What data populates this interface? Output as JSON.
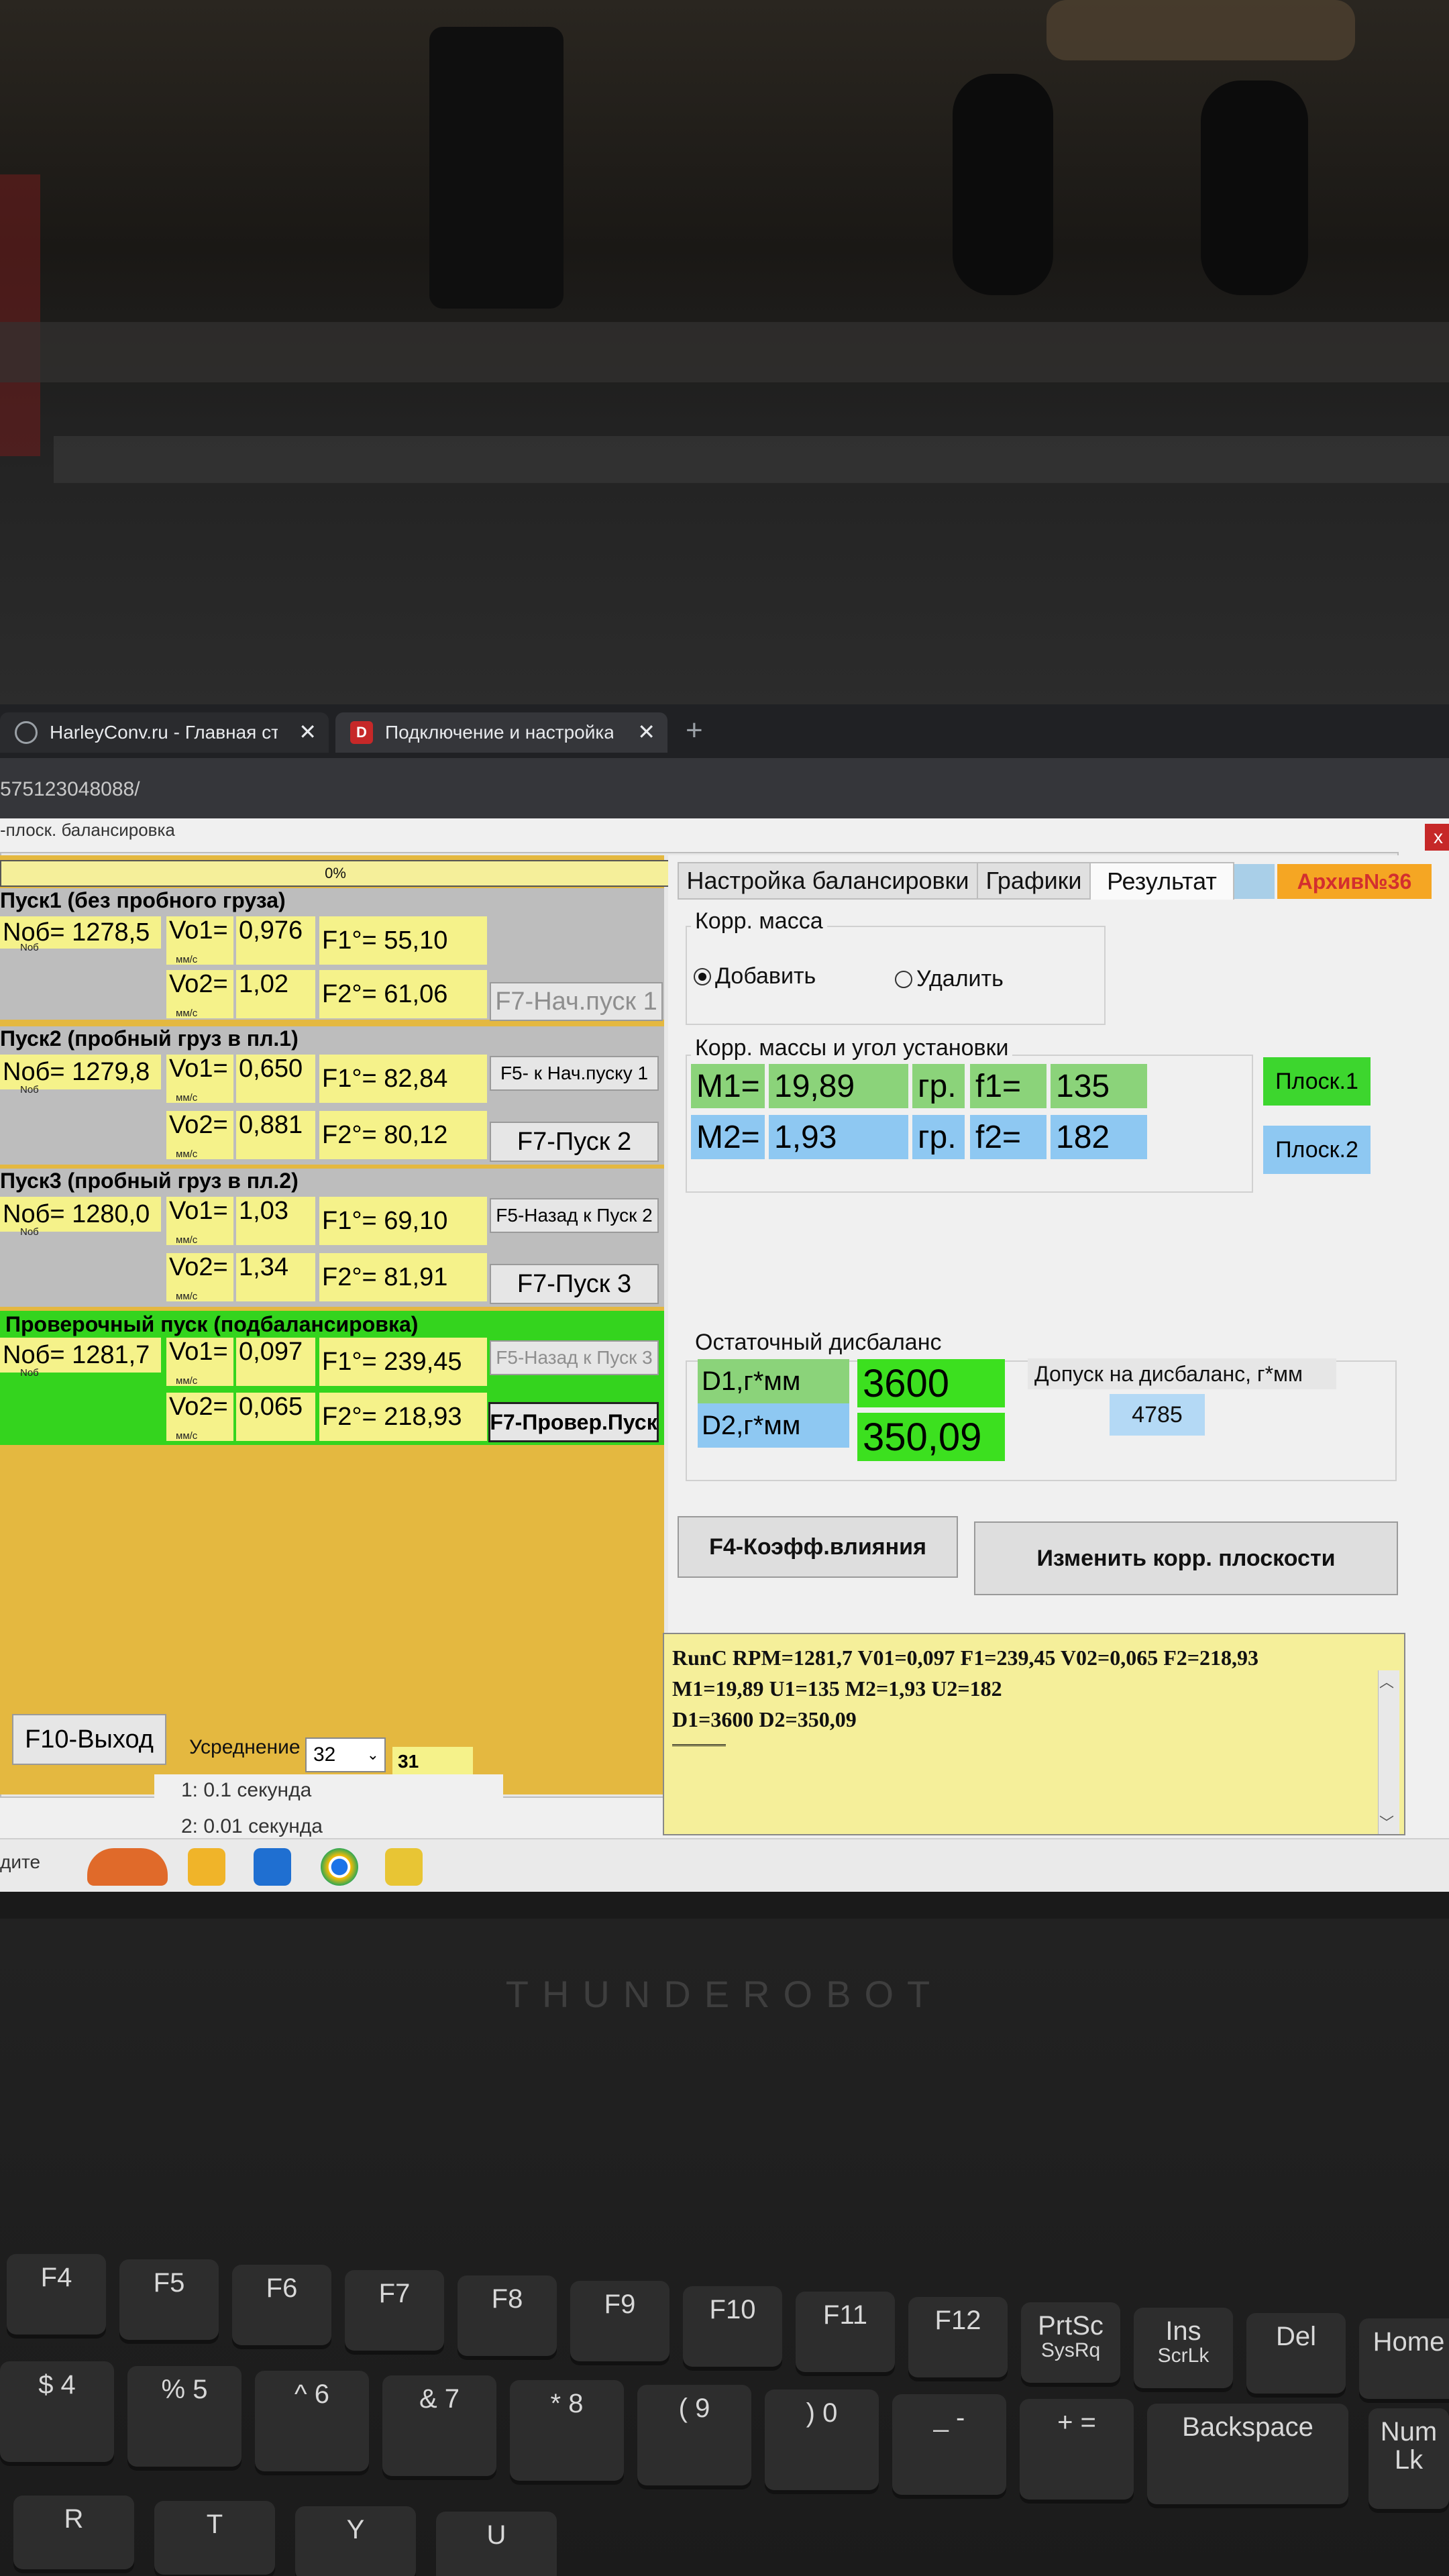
{
  "browser": {
    "tabs": [
      {
        "title": "HarleyConv.ru - Главная стран",
        "icon": "globe-icon"
      },
      {
        "title": "Подключение и настройка ча",
        "icon": "d-logo-icon"
      }
    ],
    "new_tab": "+",
    "close": "✕",
    "url": "575123048088/"
  },
  "window": {
    "title": "-плоск. балансировка",
    "close": "x",
    "progress": "0%"
  },
  "left": {
    "run1": {
      "title": "Пуск1 (без пробного груза)",
      "n": "Nоб= 1278,5",
      "n_sub": "Nоб",
      "vo1_label": "Vo1=",
      "vo1_unit": "мм/с",
      "vo1": "0,976",
      "f1": "F1°= 55,10",
      "vo2_label": "Vo2=",
      "vo2_unit": "мм/с",
      "vo2": "1,02",
      "f2": "F2°= 61,06",
      "btn": "F7-Нач.пуск 1"
    },
    "run2": {
      "title": "Пуск2 (пробный груз в пл.1)",
      "n": "Nоб= 1279,8",
      "n_sub": "Nоб",
      "vo1_label": "Vo1=",
      "vo1_unit": "мм/с",
      "vo1": "0,650",
      "f1": "F1°= 82,84",
      "vo2_label": "Vo2=",
      "vo2_unit": "мм/с",
      "vo2": "0,881",
      "f2": "F2°= 80,12",
      "btn_back": "F5- к Нач.пуску 1",
      "btn": "F7-Пуск 2"
    },
    "run3": {
      "title": "Пуск3 (пробный груз в пл.2)",
      "n": "Nоб= 1280,0",
      "n_sub": "Nоб",
      "vo1_label": "Vo1=",
      "vo1_unit": "мм/с",
      "vo1": "1,03",
      "f1": "F1°= 69,10",
      "vo2_label": "Vo2=",
      "vo2_unit": "мм/с",
      "vo2": "1,34",
      "f2": "F2°= 81,91",
      "btn_back": "F5-Назад к Пуск 2",
      "btn": "F7-Пуск 3"
    },
    "check": {
      "title": "Проверочный пуск (подбалансировка)",
      "n": "Nоб= 1281,7",
      "n_sub": "Nоб",
      "vo1_label": "Vo1=",
      "vo1_unit": "мм/с",
      "vo1": "0,097",
      "f1": "F1°= 239,45",
      "vo2_label": "Vo2=",
      "vo2_unit": "мм/с",
      "vo2": "0,065",
      "f2": "F2°= 218,93",
      "btn_back": "F5-Назад к Пуск 3",
      "btn": "F7-Провер.Пуск"
    },
    "exit": "F10-Выход",
    "averaging_label": "Усреднение",
    "averaging_value": "32",
    "averaging_count": "31",
    "dropdown_items": [
      "1: 0.1 секунда",
      "2: 0.01 секунда"
    ]
  },
  "right": {
    "tabs": [
      "Настройка балансировки",
      "Графики",
      "Результат"
    ],
    "archive": "Архив№36",
    "corr_mass": {
      "legend": "Корр. масса",
      "add": "Добавить",
      "remove": "Удалить"
    },
    "corr_masses": {
      "legend": "Корр. массы и угол установки",
      "m1_label": "M1=",
      "m1": "19,89",
      "unit1": "гр.",
      "f1_label": "f1=",
      "f1": "135",
      "m2_label": "M2=",
      "m2": "1,93",
      "unit2": "гр.",
      "f2_label": "f2=",
      "f2": "182",
      "plane1": "Плоск.1",
      "plane2": "Плоск.2"
    },
    "residual": {
      "legend": "Остаточный дисбаланс",
      "d1_label": "D1,г*мм",
      "d1": "3600",
      "d2_label": "D2,г*мм",
      "d2": "350,09",
      "tol_label": "Допуск на дисбаланс, г*мм",
      "tol": "4785"
    },
    "btn_coef": "F4-Коэфф.влияния",
    "btn_change": "Изменить корр. плоскости",
    "log": [
      "RunC  RPM=1281,7 V01=0,097 F1=239,45 V02=0,065 F2=218,93",
      "M1=19,89 U1=135 M2=1,93 U2=182",
      "D1=3600 D2=350,09"
    ]
  },
  "taskbar": {
    "search": "дите"
  },
  "laptop": {
    "brand": "THUNDEROBOT",
    "fkeys": [
      "F4",
      "F5",
      "F6",
      "F7",
      "F8",
      "F9",
      "F10",
      "F11",
      "F12",
      "PrtSc",
      "Ins",
      "Del",
      "Home"
    ],
    "fkeys_sub": [
      "",
      "",
      "",
      "",
      "",
      "",
      "",
      "",
      "",
      "SysRq",
      "ScrLk",
      "",
      ""
    ],
    "numkeys": [
      "$ 4",
      "% 5",
      "^ 6",
      "& 7",
      "* 8",
      "( 9",
      ") 0",
      "_ -",
      "+ =",
      "Backspace",
      "Num Lk"
    ],
    "letters": [
      "R",
      "T",
      "Y",
      "U"
    ]
  }
}
